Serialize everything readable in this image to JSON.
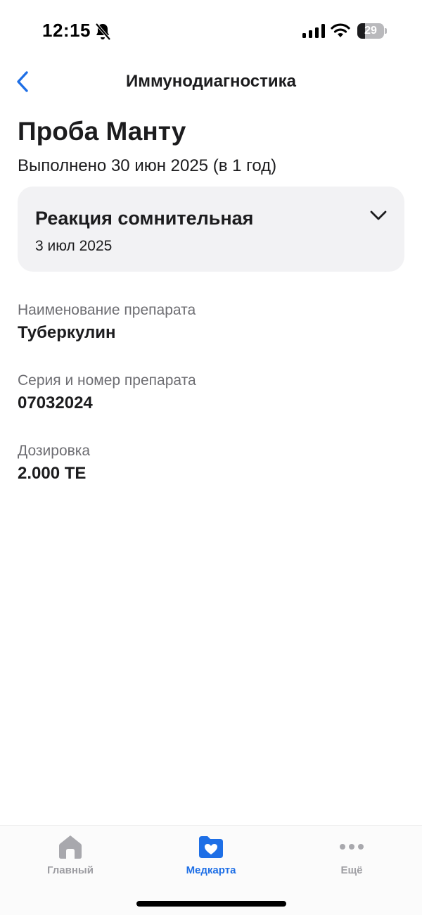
{
  "status_bar": {
    "time": "12:15",
    "battery_level": "29",
    "battery_fraction": 0.29,
    "icons": [
      "bell-slash-icon",
      "cellular-signal-icon",
      "wifi-icon",
      "battery-icon"
    ]
  },
  "nav": {
    "back_icon": "chevron-left-icon",
    "title": "Иммунодиагностика"
  },
  "test": {
    "title": "Проба Манту",
    "performed": "Выполнено 30 июн 2025 (в 1 год)"
  },
  "reaction": {
    "title": "Реакция сомнительная",
    "date": "3 июл 2025",
    "expand_icon": "chevron-down-icon"
  },
  "fields": [
    {
      "label": "Наименование препарата",
      "value": "Туберкулин"
    },
    {
      "label": "Серия и номер препарата",
      "value": "07032024"
    },
    {
      "label": "Дозировка",
      "value": "2.000 ТЕ"
    }
  ],
  "tab_bar": {
    "tabs": [
      {
        "label": "Главный",
        "icon": "home-icon",
        "active": false
      },
      {
        "label": "Медкарта",
        "icon": "folder-heart-icon",
        "active": true
      },
      {
        "label": "Ещё",
        "icon": "more-dots-icon",
        "active": false
      }
    ]
  },
  "colors": {
    "accent": "#1e6fe6",
    "inactive_tab": "#9d9da2",
    "card_background": "#f2f2f4",
    "secondary_text": "#6d6d72"
  }
}
